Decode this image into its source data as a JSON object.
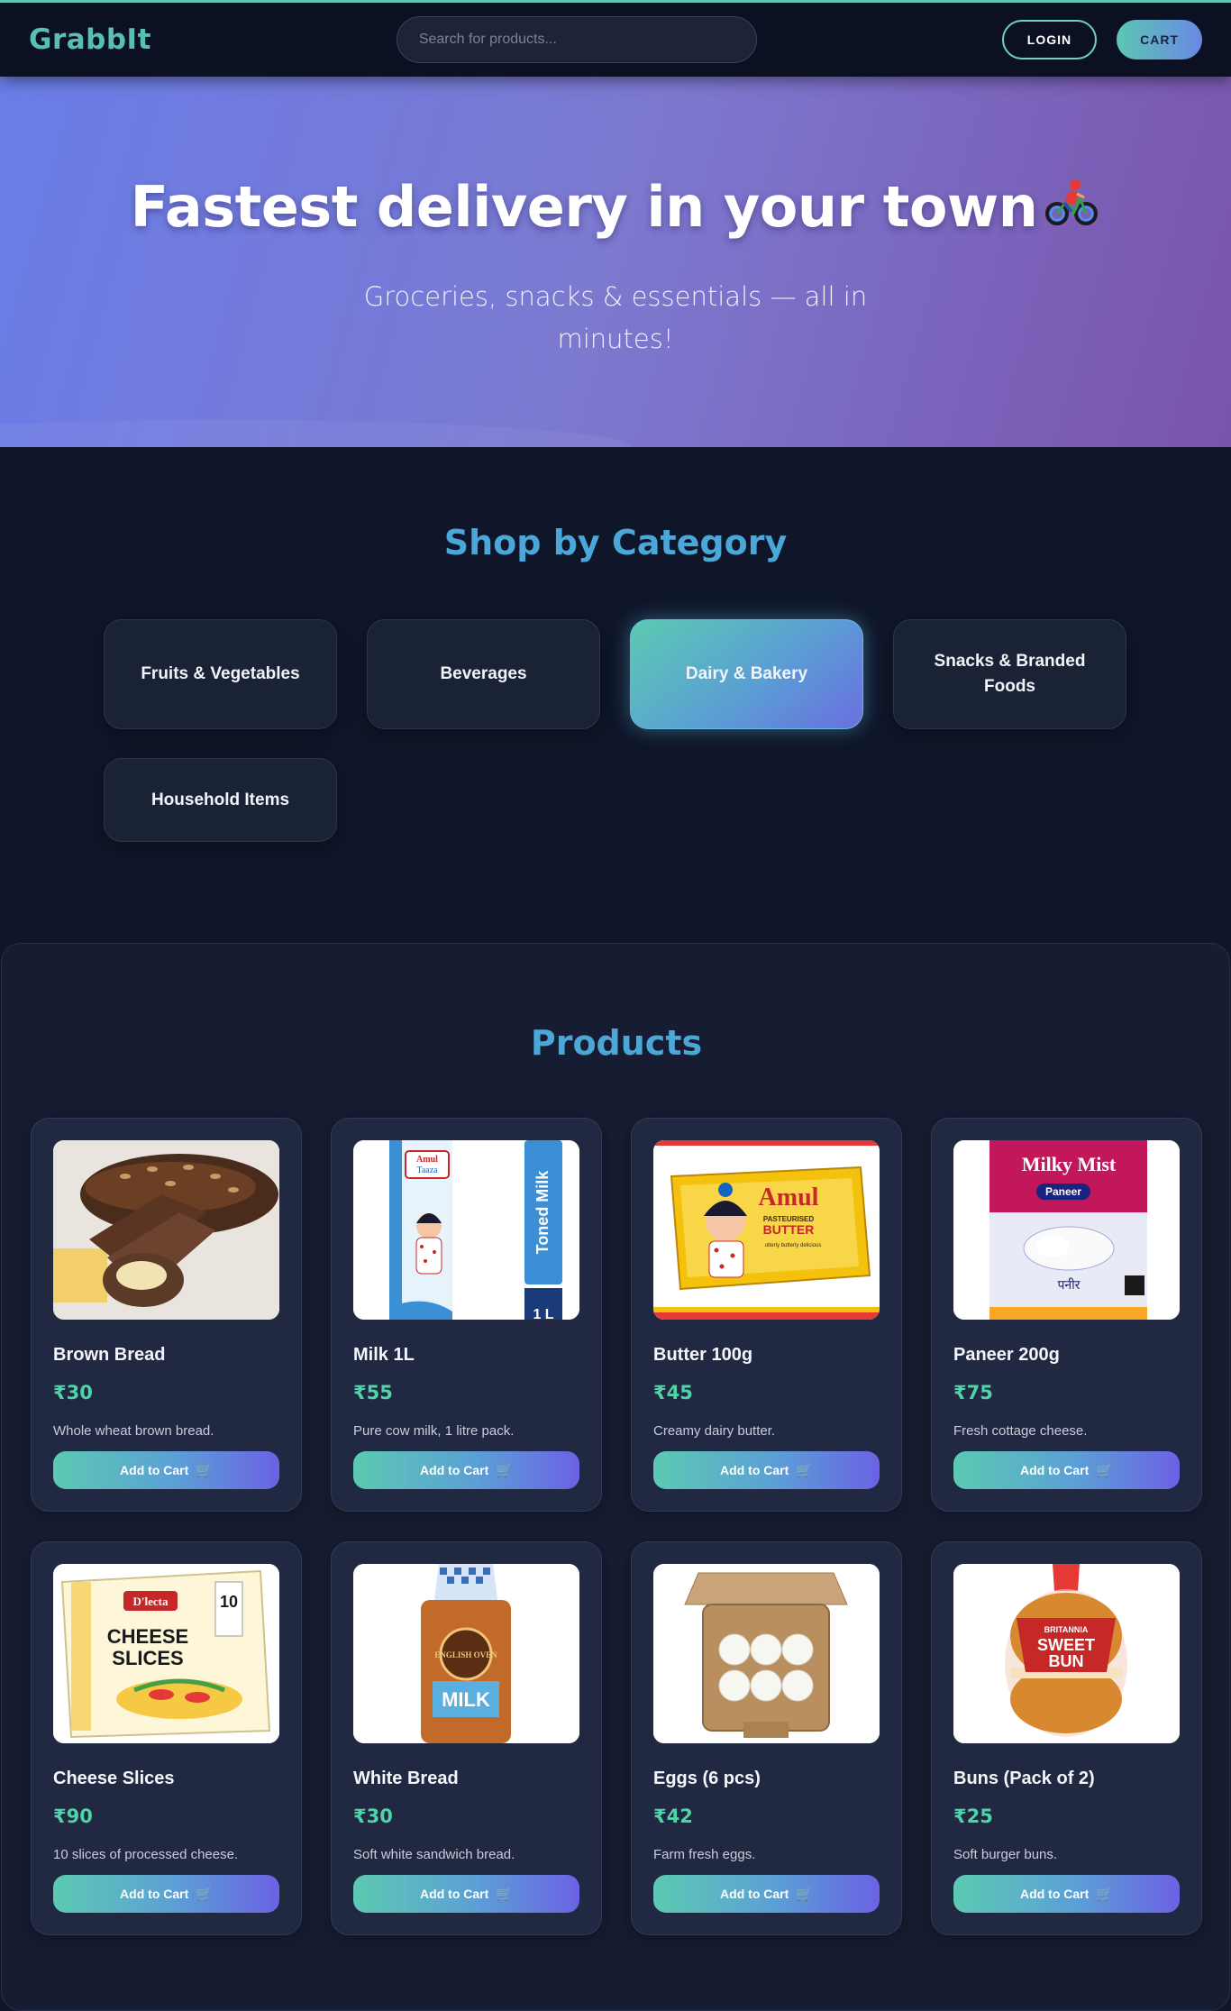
{
  "nav": {
    "brand": "GrabbIt",
    "search_placeholder": "Search for products...",
    "login_label": "LOGIN",
    "cart_label": "CART"
  },
  "hero": {
    "title": "Fastest delivery in your town",
    "subtitle": "Groceries, snacks & essentials — all in minutes!",
    "icon": "bicycle-rider-icon"
  },
  "categories": {
    "title": "Shop by Category",
    "items": [
      {
        "label": "Fruits & Vegetables",
        "active": false
      },
      {
        "label": "Beverages",
        "active": false
      },
      {
        "label": "Dairy & Bakery",
        "active": true
      },
      {
        "label": "Snacks & Branded Foods",
        "active": false
      },
      {
        "label": "Household Items",
        "active": false
      }
    ]
  },
  "products": {
    "title": "Products",
    "add_label": "Add to Cart",
    "add_icon": "cart-icon",
    "items": [
      {
        "name": "Brown Bread",
        "price": "₹30",
        "desc": "Whole wheat brown bread.",
        "image": "brown-bread-image"
      },
      {
        "name": "Milk 1L",
        "price": "₹55",
        "desc": "Pure cow milk, 1 litre pack.",
        "image": "milk-pack-image",
        "image_text": [
          "Amul",
          "Taaza",
          "Toned Milk",
          "1 L"
        ]
      },
      {
        "name": "Butter 100g",
        "price": "₹45",
        "desc": "Creamy dairy butter.",
        "image": "butter-pack-image",
        "image_text": [
          "Amul",
          "PASTEURISED",
          "BUTTER",
          "utterly butterly delicious"
        ]
      },
      {
        "name": "Paneer 200g",
        "price": "₹75",
        "desc": "Fresh cottage cheese.",
        "image": "paneer-pack-image",
        "image_text": [
          "Milky Mist",
          "Paneer",
          "पनीर"
        ]
      },
      {
        "name": "Cheese Slices",
        "price": "₹90",
        "desc": "10 slices of processed cheese.",
        "image": "cheese-slices-image",
        "image_text": [
          "D'lecta",
          "CHEESE",
          "SLICES",
          "10"
        ]
      },
      {
        "name": "White Bread",
        "price": "₹30",
        "desc": "Soft white sandwich bread.",
        "image": "white-bread-image",
        "image_text": [
          "ENGLISH OVEN",
          "MILK"
        ]
      },
      {
        "name": "Eggs (6 pcs)",
        "price": "₹42",
        "desc": "Farm fresh eggs.",
        "image": "eggs-carton-image"
      },
      {
        "name": "Buns (Pack of 2)",
        "price": "₹25",
        "desc": "Soft burger buns.",
        "image": "burger-buns-image",
        "image_text": [
          "BRITANNIA",
          "SWEET",
          "BUN"
        ]
      }
    ]
  },
  "colors": {
    "accent_teal": "#5ccab2",
    "accent_blue": "#4ba7d8",
    "accent_purple": "#6b62e4",
    "price_green": "#4fd3a9",
    "background": "#0f1629"
  }
}
